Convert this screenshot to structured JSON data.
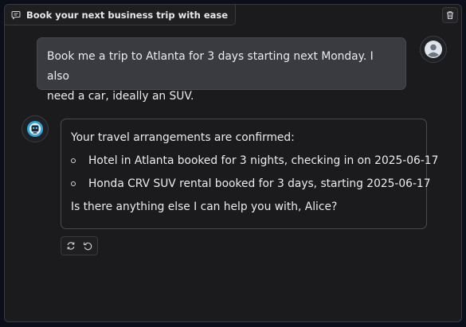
{
  "chat": {
    "title": "Book your next business trip with ease",
    "title_icon": "chat-bubble-icon",
    "delete_icon": "trash-icon"
  },
  "messages": {
    "user": {
      "avatar_icon": "user-silhouette-icon",
      "line1": "Book me a trip to Atlanta for 3 days starting next Monday. I also",
      "line2": "need a car, ideally an SUV."
    },
    "assistant": {
      "avatar_icon": "assistant-logo-icon",
      "intro": "Your travel arrangements are confirmed:",
      "items": [
        "Hotel in Atlanta booked for 3 nights, checking in on 2025-06-17",
        "Honda CRV SUV rental booked for 3 days, starting 2025-06-17"
      ],
      "closing": "Is there anything else I can help you with, Alice?"
    }
  },
  "actions": {
    "retry_icon": "refresh-icon",
    "undo_icon": "undo-icon"
  },
  "colors": {
    "background": "#0b0f19",
    "panel": "#1b1b1d",
    "user_bubble": "#3a3b40",
    "border": "#4a4b51",
    "text": "#ececee"
  }
}
